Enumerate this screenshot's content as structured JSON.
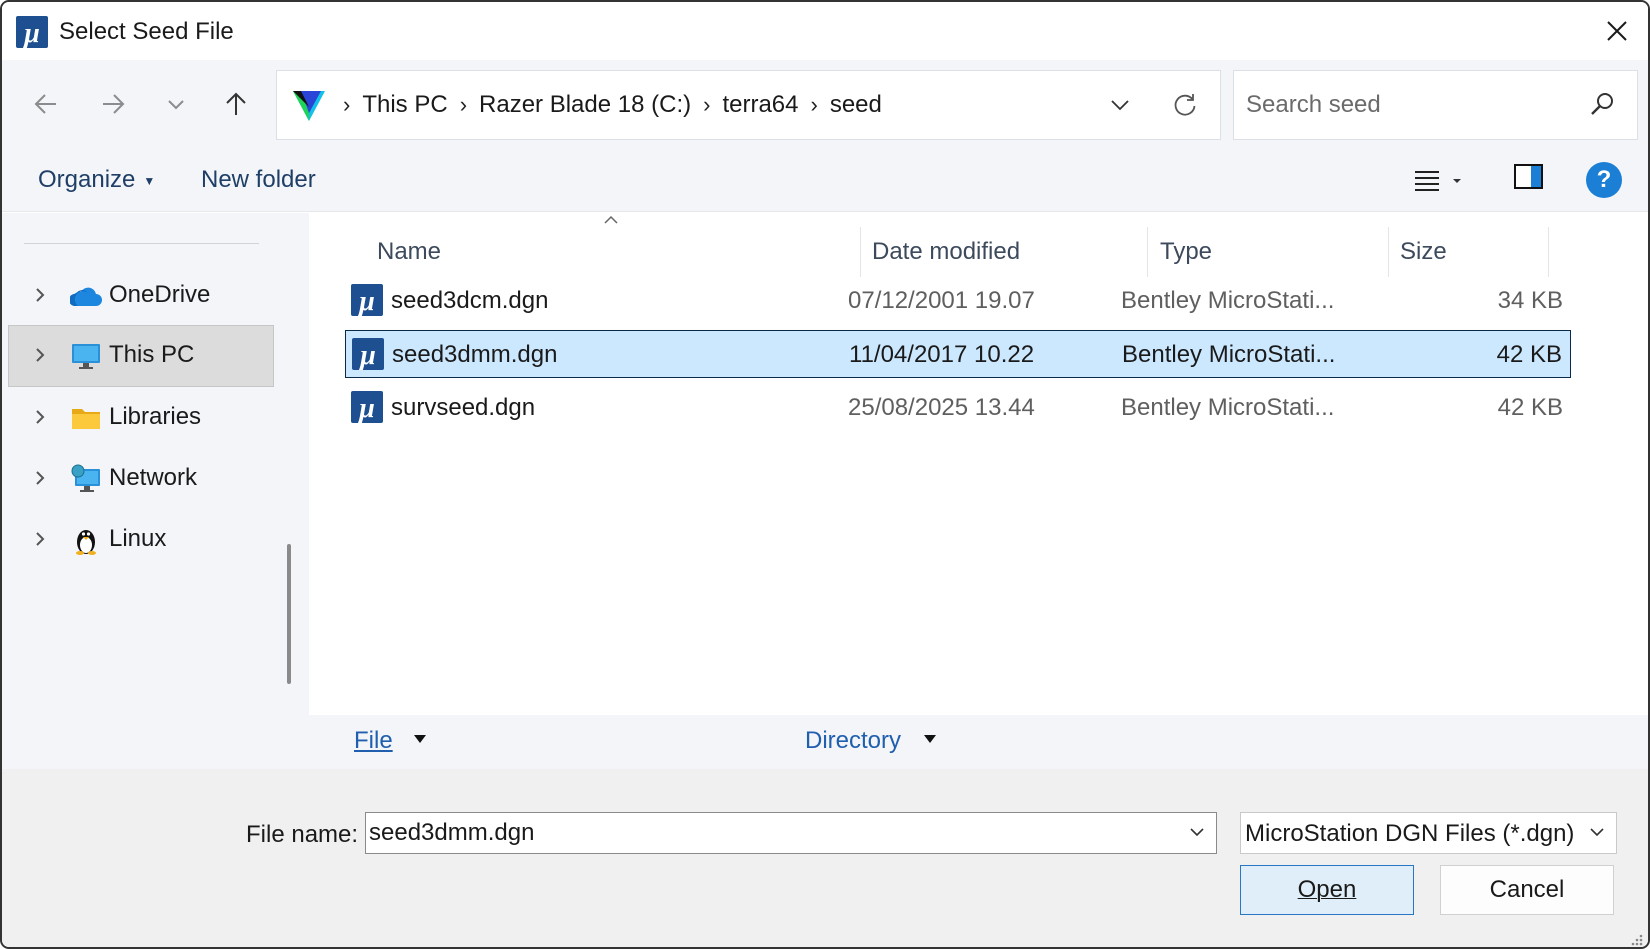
{
  "window": {
    "title": "Select Seed File",
    "icon": "microstation-icon"
  },
  "nav": {
    "back_icon": "arrow-left-icon",
    "forward_icon": "arrow-right-icon",
    "recent_icon": "chevron-down-icon",
    "up_icon": "arrow-up-icon",
    "breadcrumbs": [
      "This PC",
      "Razer Blade 18 (C:)",
      "terra64",
      "seed"
    ],
    "search_placeholder": "Search seed"
  },
  "toolbar": {
    "organize_label": "Organize",
    "new_folder_label": "New folder",
    "help_label": "?"
  },
  "sidebar": {
    "items": [
      {
        "label": "OneDrive",
        "icon": "cloud-icon",
        "selected": false
      },
      {
        "label": "This PC",
        "icon": "monitor-icon",
        "selected": true
      },
      {
        "label": "Libraries",
        "icon": "folder-icon",
        "selected": false
      },
      {
        "label": "Network",
        "icon": "network-icon",
        "selected": false
      },
      {
        "label": "Linux",
        "icon": "penguin-icon",
        "selected": false
      }
    ]
  },
  "filelist": {
    "columns": [
      "Name",
      "Date modified",
      "Type",
      "Size"
    ],
    "rows": [
      {
        "name": "seed3dcm.dgn",
        "date": "07/12/2001 19.07",
        "type": "Bentley MicroStati...",
        "size": "34 KB",
        "selected": false
      },
      {
        "name": "seed3dmm.dgn",
        "date": "11/04/2017 10.22",
        "type": "Bentley MicroStati...",
        "size": "42 KB",
        "selected": true
      },
      {
        "name": "survseed.dgn",
        "date": "25/08/2025 13.44",
        "type": "Bentley MicroStati...",
        "size": "42 KB",
        "selected": false
      }
    ]
  },
  "modes": {
    "file_label": "File",
    "directory_label": "Directory"
  },
  "bottom": {
    "filename_label": "File name:",
    "filename_value": "seed3dmm.dgn",
    "filetype_value": "MicroStation DGN Files (*.dgn)",
    "open_label": "Open",
    "cancel_label": "Cancel"
  },
  "colors": {
    "accent": "#1b7fd6",
    "selection_bg": "#cce8ff",
    "panel_bg": "#f3f5f9"
  }
}
